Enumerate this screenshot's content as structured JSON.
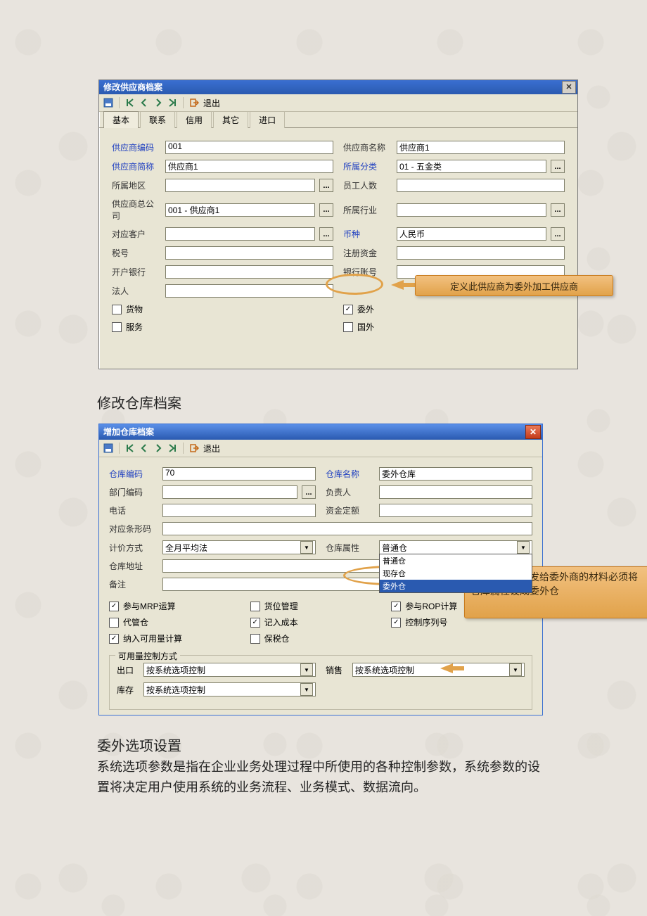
{
  "dialog1": {
    "title": "修改供应商档案",
    "toolbar_exit": "退出",
    "tabs": [
      "基本",
      "联系",
      "信用",
      "其它",
      "进口"
    ],
    "fields": {
      "code_label": "供应商编码",
      "code_value": "001",
      "name_label": "供应商名称",
      "name_value": "供应商1",
      "short_label": "供应商简称",
      "short_value": "供应商1",
      "class_label": "所属分类",
      "class_value": "01 - 五金类",
      "region_label": "所属地区",
      "region_value": "",
      "emp_label": "员工人数",
      "emp_value": "",
      "hq_label": "供应商总公司",
      "hq_value": "001 - 供应商1",
      "industry_label": "所属行业",
      "industry_value": "",
      "cust_label": "对应客户",
      "cust_value": "",
      "currency_label": "币种",
      "currency_value": "人民币",
      "tax_label": "税号",
      "tax_value": "",
      "regcap_label": "注册资金",
      "regcap_value": "",
      "bank_label": "开户银行",
      "bank_value": "",
      "acct_label": "银行账号",
      "acct_value": "",
      "legal_label": "法人",
      "legal_value": ""
    },
    "checks": {
      "goods": "货物",
      "outsrc": "委外",
      "service": "服务",
      "foreign": "国外"
    }
  },
  "annotation1": "定义此供应商为委外加工供应商",
  "heading1": "修改仓库档案",
  "dialog2": {
    "title": "增加仓库档案",
    "toolbar_exit": "退出",
    "fields": {
      "whcode_label": "仓库编码",
      "whcode_value": "70",
      "whname_label": "仓库名称",
      "whname_value": "委外仓库",
      "dept_label": "部门编码",
      "dept_value": "",
      "owner_label": "负责人",
      "owner_value": "",
      "phone_label": "电话",
      "phone_value": "",
      "fund_label": "资金定额",
      "fund_value": "",
      "barcode_label": "对应条形码",
      "barcode_value": "",
      "pricing_label": "计价方式",
      "pricing_value": "全月平均法",
      "attr_label": "仓库属性",
      "attr_value": "普通仓",
      "attr_options": [
        "普通仓",
        "现存仓",
        "委外仓"
      ],
      "addr_label": "仓库地址",
      "addr_value": "",
      "remark_label": "备注",
      "remark_value": ""
    },
    "checks": {
      "mrp": "参与MRP运算",
      "loc": "货位管理",
      "rop": "参与ROP计算",
      "consign": "代管仓",
      "cost": "记入成本",
      "serial": "控制序列号",
      "avail": "纳入可用量计算",
      "bonded": "保税仓"
    },
    "fieldset": {
      "legend": "可用量控制方式",
      "out_label": "出口",
      "out_value": "按系统选项控制",
      "sale_label": "销售",
      "sale_value": "按系统选项控制",
      "stock_label": "库存",
      "stock_value": "按系统选项控制"
    }
  },
  "annotation2": "为了实现管理发给委外商的材料必须将仓库属性设成委外仓",
  "heading2": "委外选项设置",
  "paragraph": "系统选项参数是指在企业业务处理过程中所使用的各种控制参数，系统参数的设置将决定用户使用系统的业务流程、业务模式、数据流向。"
}
